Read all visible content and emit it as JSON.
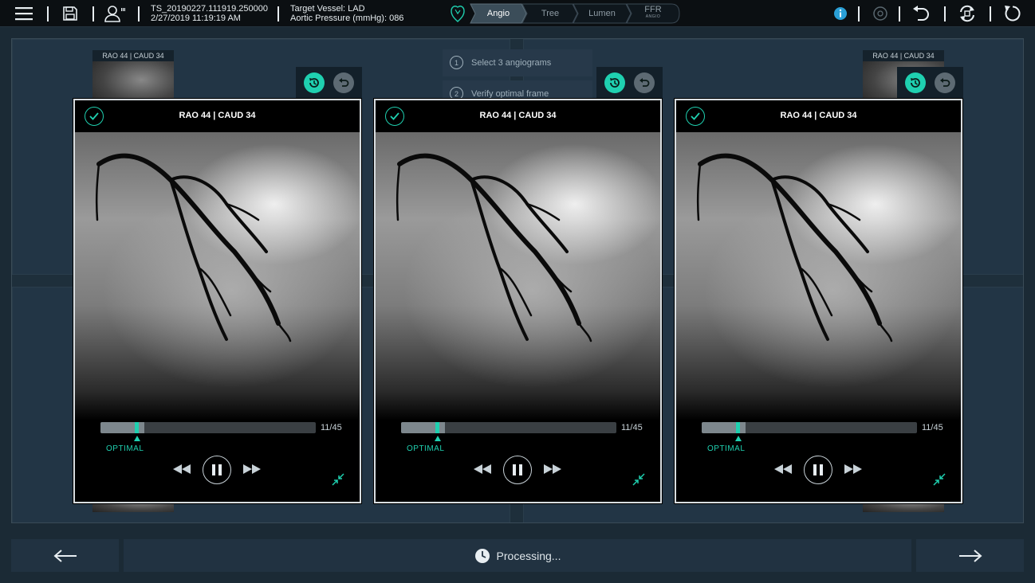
{
  "header": {
    "session_id": "TS_20190227.111919.250000",
    "session_datetime": "2/27/2019 11:19:19 AM",
    "target_vessel": "Target Vessel: LAD",
    "aortic_pressure": "Aortic Pressure (mmHg): 086",
    "workflow_steps": [
      {
        "label": "Angio",
        "active": true
      },
      {
        "label": "Tree",
        "active": false
      },
      {
        "label": "Lumen",
        "active": false
      },
      {
        "label": "FFR",
        "sub": "ANGIO",
        "active": false
      }
    ]
  },
  "background": {
    "thumb_label": "RAO 44 | CAUD 34",
    "instructions": [
      {
        "num": "1",
        "text": "Select 3 angiograms"
      },
      {
        "num": "2",
        "text": "Verify optimal frame"
      }
    ]
  },
  "panels": [
    {
      "title": "RAO 44 | CAUD 34",
      "frame": "11/45",
      "optimal_label": "OPTIMAL",
      "progress": 0.16,
      "selected": true
    },
    {
      "title": "RAO 44 | CAUD 34",
      "frame": "11/45",
      "optimal_label": "OPTIMAL",
      "progress": 0.16,
      "selected": true
    },
    {
      "title": "RAO 44 | CAUD 34",
      "frame": "11/45",
      "optimal_label": "OPTIMAL",
      "progress": 0.16,
      "selected": true
    }
  ],
  "footer": {
    "status": "Processing..."
  },
  "colors": {
    "accent": "#1fd0b0",
    "topbar_bg": "#0b0f12",
    "workspace_bg": "#1e2f3b"
  },
  "icons": {
    "menu": "hamburger-icon",
    "save": "save-icon",
    "user": "user-icon",
    "heart": "heart-icon",
    "info": "info-icon",
    "disabled_target": "target-icon",
    "undo": "undo-icon",
    "sync": "sync-icon",
    "reset": "reset-icon"
  }
}
